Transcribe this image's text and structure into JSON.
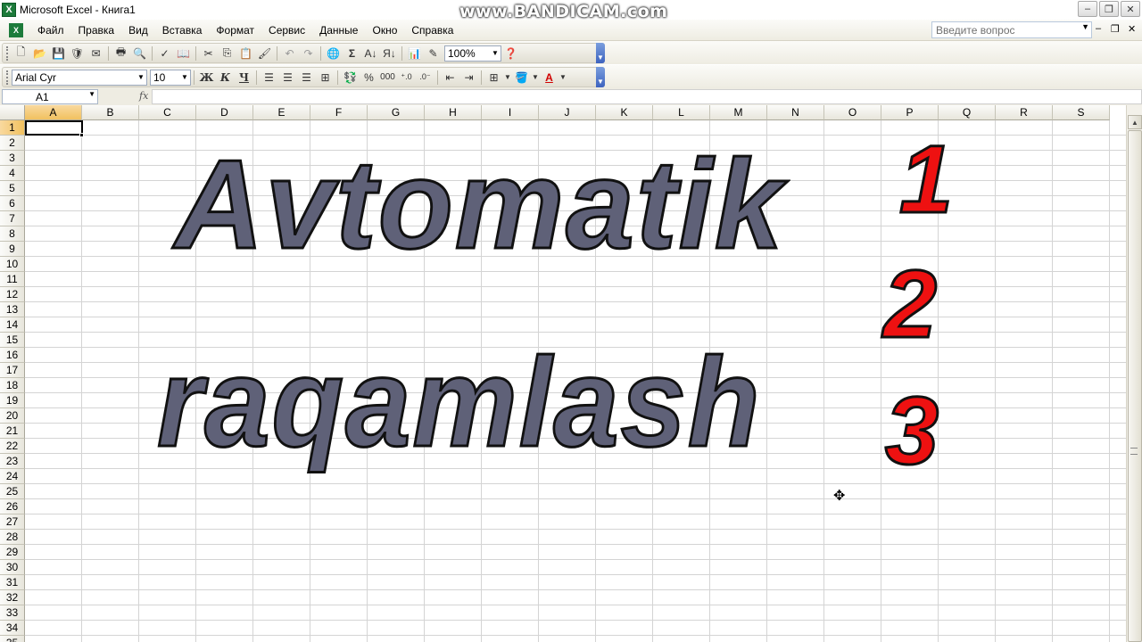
{
  "window": {
    "title": "Microsoft Excel - Книга1",
    "watermark": "www.BANDICAM.com"
  },
  "window_controls": [
    "–",
    "❐",
    "✕"
  ],
  "menu": {
    "items": [
      "Файл",
      "Правка",
      "Вид",
      "Вставка",
      "Формат",
      "Сервис",
      "Данные",
      "Окно",
      "Справка"
    ],
    "help_placeholder": "Введите вопрос",
    "doc_controls": [
      "–",
      "❐",
      "✕"
    ]
  },
  "standard_toolbar": {
    "icons": [
      "new-icon",
      "open-icon",
      "save-icon",
      "permission-icon",
      "email-icon",
      "print-icon",
      "print-preview-icon",
      "spelling-icon",
      "research-icon",
      "cut-icon",
      "copy-icon",
      "paste-icon",
      "format-painter-icon",
      "undo-icon",
      "redo-icon",
      "hyperlink-icon",
      "autosum-icon",
      "sort-ascending-icon",
      "sort-descending-icon",
      "chart-wizard-icon",
      "drawing-icon",
      "help-icon"
    ],
    "zoom": "100%"
  },
  "format_toolbar": {
    "font": "Arial Cyr",
    "size": "10",
    "bold": "Ж",
    "italic": "К",
    "underline": "Ч",
    "percent": "%",
    "thousands": "000"
  },
  "formula_bar": {
    "name_box": "A1",
    "fx": "fx",
    "content": ""
  },
  "grid": {
    "columns": [
      "A",
      "B",
      "C",
      "D",
      "E",
      "F",
      "G",
      "H",
      "I",
      "J",
      "K",
      "L",
      "M",
      "N",
      "O",
      "P",
      "Q",
      "R",
      "S"
    ],
    "rows": [
      "1",
      "2",
      "3",
      "4",
      "5",
      "6",
      "7",
      "8",
      "9",
      "10",
      "11",
      "12",
      "13",
      "14",
      "15",
      "16",
      "17",
      "18",
      "19",
      "20",
      "21",
      "22",
      "23",
      "24",
      "25",
      "26",
      "27",
      "28",
      "29",
      "30",
      "31",
      "32",
      "33",
      "34",
      "35"
    ],
    "active_cell": "A1"
  },
  "wordart": {
    "line1": "Avtomatik",
    "line2": "raqamlash",
    "numbers": [
      "1",
      "2",
      "3"
    ],
    "text_color": "#5f6178",
    "number_color": "#ee1111"
  }
}
